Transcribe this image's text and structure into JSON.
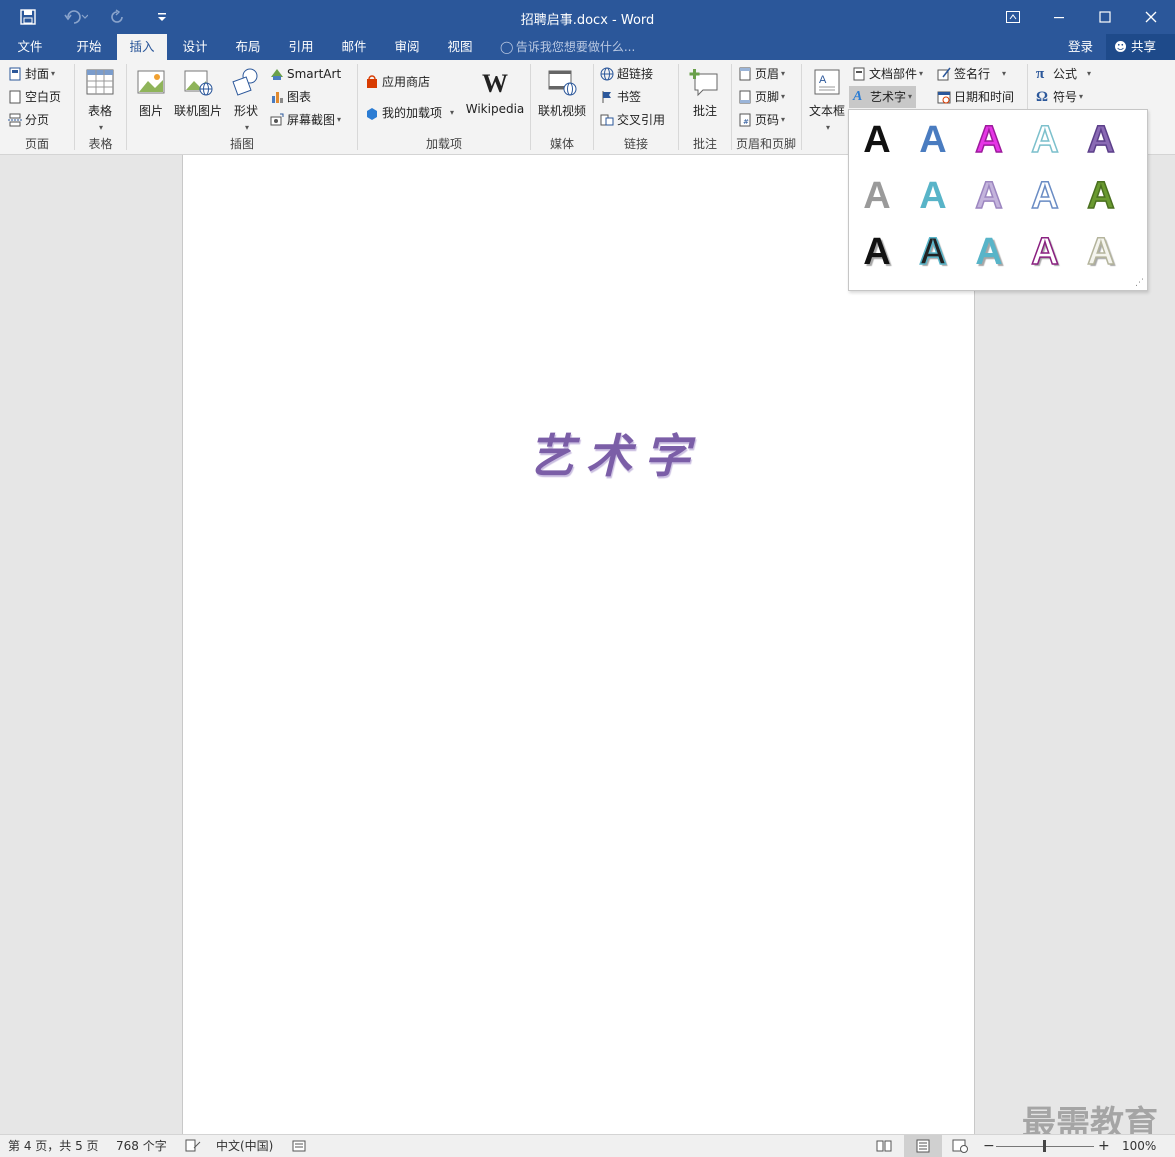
{
  "window": {
    "title": "招聘启事.docx - Word",
    "controls": [
      "ribbon-display",
      "minimize",
      "maximize",
      "close"
    ]
  },
  "quick_access": {
    "save_icon": "save-icon",
    "undo_icon": "undo-icon",
    "redo_icon": "redo-icon",
    "customize_icon": "customize-qat-icon"
  },
  "tabs": [
    {
      "label": "文件"
    },
    {
      "label": "开始"
    },
    {
      "label": "插入",
      "active": true
    },
    {
      "label": "设计"
    },
    {
      "label": "布局"
    },
    {
      "label": "引用"
    },
    {
      "label": "邮件"
    },
    {
      "label": "审阅"
    },
    {
      "label": "视图"
    }
  ],
  "tell_me": "告诉我您想要做什么...",
  "account": {
    "login": "登录",
    "share": "共享"
  },
  "ribbon": {
    "pages": {
      "label": "页面",
      "cover": "封面",
      "blank": "空白页",
      "break": "分页"
    },
    "tables": {
      "label": "表格",
      "table": "表格"
    },
    "illustrations": {
      "label": "插图",
      "picture": "图片",
      "online_picture": "联机图片",
      "shapes": "形状",
      "smartart": "SmartArt",
      "chart": "图表",
      "screenshot": "屏幕截图"
    },
    "addins": {
      "label": "加载项",
      "store": "应用商店",
      "my_addins": "我的加载项",
      "wikipedia": "Wikipedia"
    },
    "media": {
      "label": "媒体",
      "online_video": "联机视频"
    },
    "links": {
      "label": "链接",
      "hyperlink": "超链接",
      "bookmark": "书签",
      "cross_ref": "交叉引用"
    },
    "comments": {
      "label": "批注",
      "comment": "批注"
    },
    "header_footer": {
      "label": "页眉和页脚",
      "header": "页眉",
      "footer": "页脚",
      "page_number": "页码"
    },
    "text": {
      "textbox": "文本框",
      "quick_parts": "文档部件",
      "wordart": "艺术字",
      "signature": "签名行",
      "datetime": "日期和时间"
    },
    "symbols": {
      "equation": "公式",
      "symbol": "符号"
    }
  },
  "wordart_gallery": {
    "glyph": "A",
    "styles": [
      {
        "fill": "#111111",
        "outline": "none"
      },
      {
        "fill": "#4a7cc0",
        "outline": "none"
      },
      {
        "fill": "#e636e6",
        "outline": "#9c1b9c"
      },
      {
        "fill": "#ffffff",
        "outline": "#7cc0cc"
      },
      {
        "fill": "#8a6ab4",
        "outline": "#5c3f8a"
      },
      {
        "fill": "#9a9a9a",
        "outline": "none"
      },
      {
        "fill": "#58b4c8",
        "outline": "none"
      },
      {
        "fill": "#c4b4dc",
        "outline": "#9c86c0"
      },
      {
        "fill": "#ffffff",
        "outline": "#6a8cc4"
      },
      {
        "fill": "#6a9a30",
        "outline": "#4a7020"
      },
      {
        "fill": "#111111",
        "outline": "none"
      },
      {
        "fill": "#222222",
        "outline": "#58b4c8"
      },
      {
        "fill": "#58b4c8",
        "outline": "none"
      },
      {
        "fill": "#ffffff",
        "outline": "#8a2080"
      },
      {
        "fill": "#f4f4ee",
        "outline": "#b4b49c"
      }
    ]
  },
  "document": {
    "wordart_text": "艺术字"
  },
  "status": {
    "page": "第 4 页，共 5 页",
    "words": "768 个字",
    "language": "中文(中国)",
    "zoom": "100%"
  },
  "watermark": "最需教育"
}
